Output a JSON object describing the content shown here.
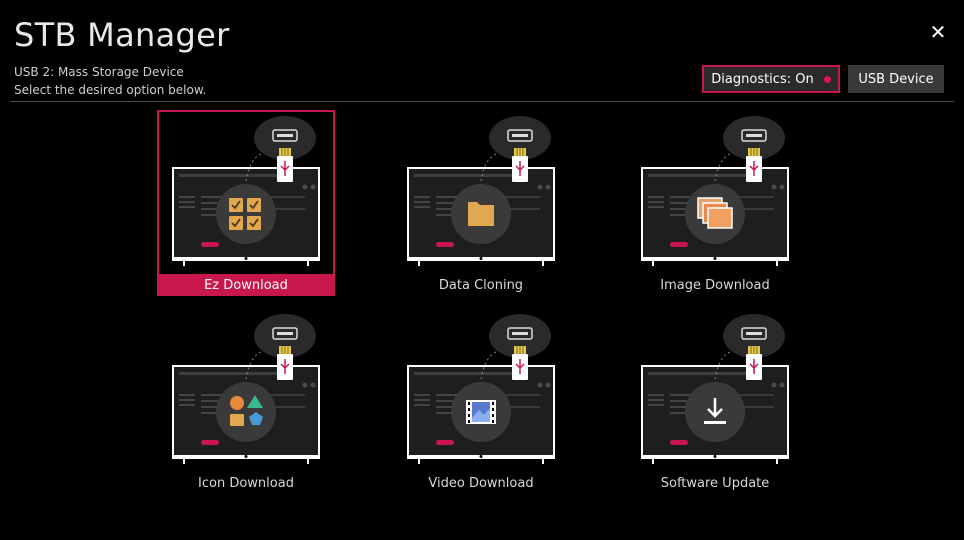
{
  "header": {
    "title": "STB Manager",
    "subtitle_1": "USB 2: Mass Storage Device",
    "subtitle_2": "Select the desired option below.",
    "close_icon": "close-icon"
  },
  "buttons": {
    "diagnostics_label": "Diagnostics: On",
    "diagnostics_dot_color": "#e0154c",
    "usb_device_label": "USB Device"
  },
  "colors": {
    "accent": "#c8174e",
    "background": "#000000"
  },
  "options": [
    {
      "label": "Ez Download",
      "icon": "checkbox-grid-icon",
      "selected": true
    },
    {
      "label": "Data Cloning",
      "icon": "folder-icon",
      "selected": false
    },
    {
      "label": "Image Download",
      "icon": "image-stack-icon",
      "selected": false
    },
    {
      "label": "Icon Download",
      "icon": "shapes-icon",
      "selected": false
    },
    {
      "label": "Video Download",
      "icon": "film-icon",
      "selected": false
    },
    {
      "label": "Software Update",
      "icon": "download-arrow-icon",
      "selected": false
    }
  ]
}
